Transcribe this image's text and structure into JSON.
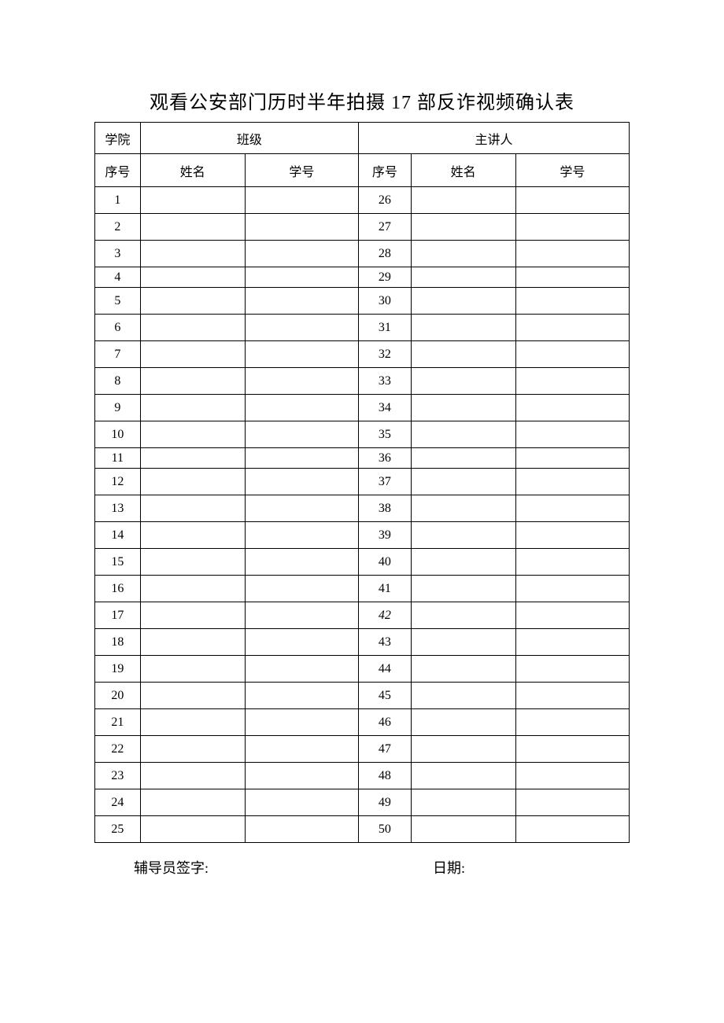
{
  "title": "观看公安部门历时半年拍摄 17 部反诈视频确认表",
  "header": {
    "college_label": "学院",
    "class_label": "班级",
    "speaker_label": "主讲人"
  },
  "columns": {
    "seq": "序号",
    "name": "姓名",
    "id": "学号"
  },
  "rows_left": [
    "1",
    "2",
    "3",
    "4",
    "5",
    "6",
    "7",
    "8",
    "9",
    "10",
    "11",
    "12",
    "13",
    "14",
    "15",
    "16",
    "17",
    "18",
    "19",
    "20",
    "21",
    "22",
    "23",
    "24",
    "25"
  ],
  "rows_right": [
    "26",
    "27",
    "28",
    "29",
    "30",
    "31",
    "32",
    "33",
    "34",
    "35",
    "36",
    "37",
    "38",
    "39",
    "40",
    "41",
    "42",
    "43",
    "44",
    "45",
    "46",
    "47",
    "48",
    "49",
    "50"
  ],
  "footer": {
    "signature_label": "辅导员签字:",
    "date_label": "日期:"
  }
}
